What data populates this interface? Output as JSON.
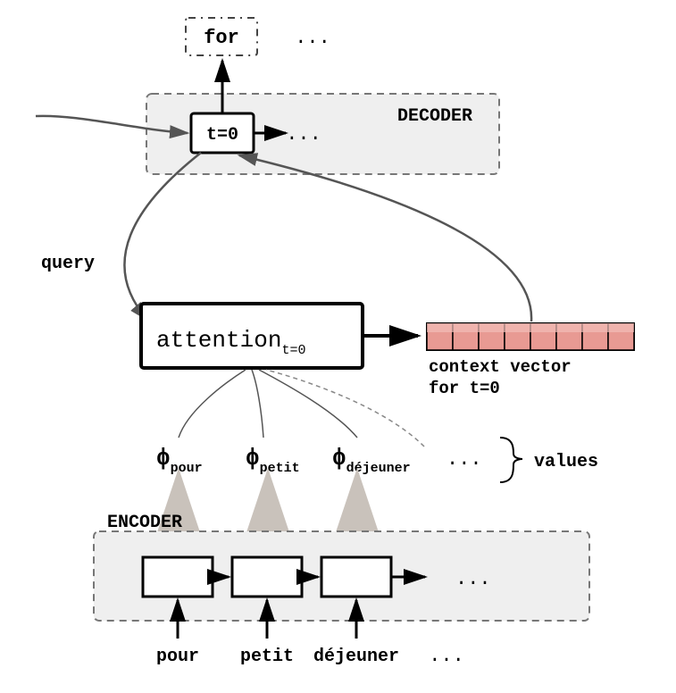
{
  "decoder": {
    "label": "DECODER",
    "output_word": "for",
    "output_ellipsis": "...",
    "step_label": "t=0",
    "step_ellipsis": "..."
  },
  "query_label": "query",
  "attention": {
    "label": "attention",
    "subscript": "t=0"
  },
  "context_vector": {
    "line1": "context vector",
    "line2": "for t=0",
    "cells": 8
  },
  "phi": {
    "symbol": "ϕ",
    "items": [
      "pour",
      "petit",
      "déjeuner"
    ],
    "ellipsis": "...",
    "values_label": "values"
  },
  "encoder": {
    "label": "ENCODER",
    "words": [
      "pour",
      "petit",
      "déjeuner"
    ],
    "ellipsis": "..."
  }
}
